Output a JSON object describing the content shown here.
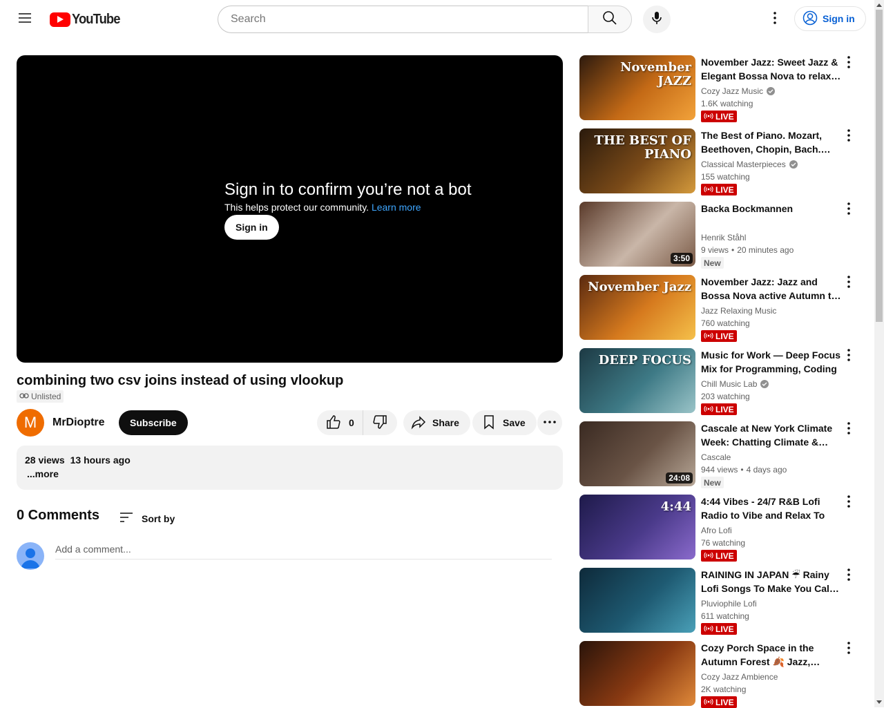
{
  "header": {
    "logo_text": "YouTube",
    "search_placeholder": "Search",
    "sign_in_label": "Sign in"
  },
  "player": {
    "message_title": "Sign in to confirm you’re not a bot",
    "message_desc": "This helps protect our community.",
    "learn_more": "Learn more",
    "sign_in_button": "Sign in"
  },
  "video": {
    "title": "combining two csv joins instead of using vlookup",
    "unlisted_label": "Unlisted",
    "channel_initial": "M",
    "channel_name": "MrDioptre",
    "subscribe_label": "Subscribe",
    "like_count": "0",
    "share_label": "Share",
    "save_label": "Save",
    "views": "28 views",
    "uploaded": "13 hours ago",
    "more_label": "...more"
  },
  "comments": {
    "count_label": "0 Comments",
    "sort_label": "Sort by",
    "input_placeholder": "Add a comment..."
  },
  "recommendations": [
    {
      "title": "November Jazz: Sweet Jazz & Elegant Bossa Nova to relax, study and work",
      "channel": "Cozy Jazz Music",
      "verified": true,
      "meta1": "1.6K watching",
      "meta2": "",
      "badge": "LIVE",
      "duration": "",
      "thumb_text": "November JAZZ",
      "thumb_colors": [
        "#2d1a0e",
        "#c46a16",
        "#f2a23a"
      ]
    },
    {
      "title": "The Best of Piano. Mozart, Beethoven, Chopin, Bach. Classical Music",
      "channel": "Classical Masterpieces",
      "verified": true,
      "meta1": "155 watching",
      "meta2": "",
      "badge": "LIVE",
      "duration": "",
      "thumb_text": "THE BEST OF PIANO",
      "thumb_colors": [
        "#2a1a0c",
        "#7a4a18",
        "#d49a3c"
      ]
    },
    {
      "title": "Backa Bockmannen",
      "channel": "Henrik Ståhl",
      "verified": false,
      "meta1": "9 views",
      "meta2": "20 minutes ago",
      "badge": "New",
      "duration": "3:50",
      "thumb_text": "",
      "thumb_colors": [
        "#5a3a2a",
        "#c9b6a8",
        "#7a5a46"
      ]
    },
    {
      "title": "November Jazz: Jazz and Bossa Nova active Autumn to enjoy",
      "channel": "Jazz Relaxing Music",
      "verified": false,
      "meta1": "760 watching",
      "meta2": "",
      "badge": "LIVE",
      "duration": "",
      "thumb_text": "November Jazz",
      "thumb_colors": [
        "#5a2a10",
        "#d67a1e",
        "#f5c04a"
      ]
    },
    {
      "title": "Music for Work — Deep Focus Mix for Programming, Coding",
      "channel": "Chill Music Lab",
      "verified": true,
      "meta1": "203 watching",
      "meta2": "",
      "badge": "LIVE",
      "duration": "",
      "thumb_text": "DEEP FOCUS",
      "thumb_colors": [
        "#1d3a44",
        "#3e7a86",
        "#9ac4c8"
      ]
    },
    {
      "title": "Cascale at New York Climate Week: Chatting Climate & Sustainability",
      "channel": "Cascale",
      "verified": false,
      "meta1": "944 views",
      "meta2": "4 days ago",
      "badge": "New",
      "duration": "24:08",
      "thumb_text": "",
      "thumb_colors": [
        "#3a2a22",
        "#6a5446",
        "#b8a898"
      ]
    },
    {
      "title": "4:44 Vibes - 24/7 R&B Lofi Radio to Vibe and Relax To",
      "channel": "Afro Lofi",
      "verified": false,
      "meta1": "76 watching",
      "meta2": "",
      "badge": "LIVE",
      "duration": "",
      "thumb_text": "4:44",
      "thumb_colors": [
        "#1e1a4a",
        "#4a3a8a",
        "#8a6acc"
      ]
    },
    {
      "title": "RAINING IN JAPAN ☔ Rainy Lofi Songs To Make You Calm Down And Relax",
      "channel": "Pluviophile Lofi",
      "verified": false,
      "meta1": "611 watching",
      "meta2": "",
      "badge": "LIVE",
      "duration": "",
      "thumb_text": "",
      "thumb_colors": [
        "#0e2a3a",
        "#1e5a72",
        "#4aa0b8"
      ]
    },
    {
      "title": "Cozy Porch Space in the Autumn Forest 🍂 Jazz, Pumpkins & Fireplace",
      "channel": "Cozy Jazz Ambience",
      "verified": false,
      "meta1": "2K watching",
      "meta2": "",
      "badge": "LIVE",
      "duration": "",
      "thumb_text": "",
      "thumb_colors": [
        "#2a140a",
        "#8a3a12",
        "#e08a3a"
      ]
    }
  ]
}
